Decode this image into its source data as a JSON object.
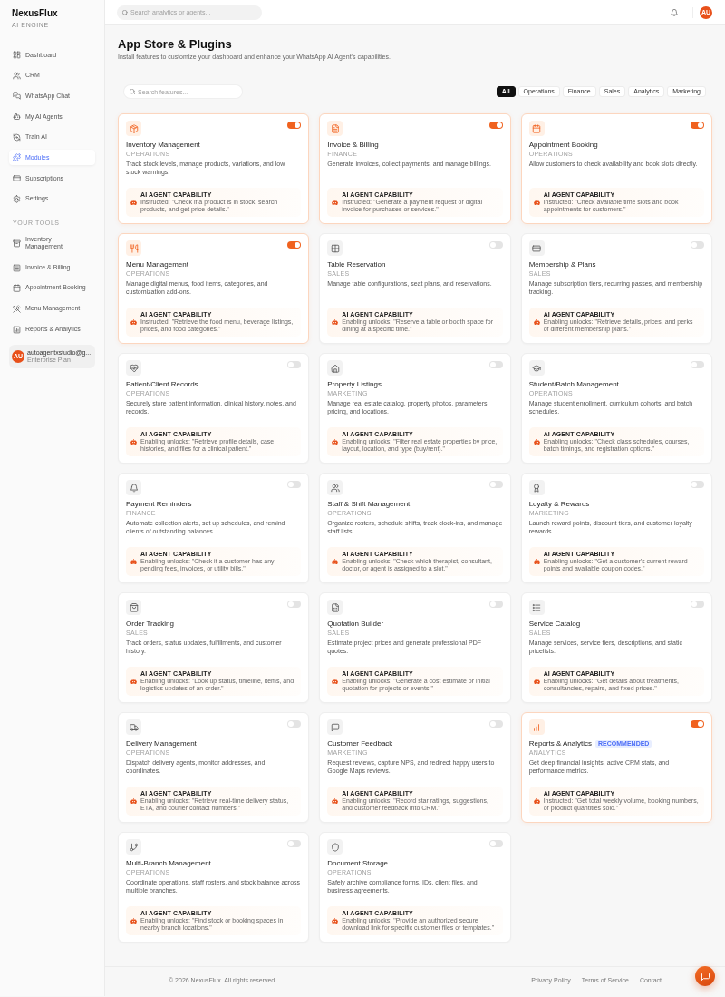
{
  "sidebar": {
    "brand": "NexusFlux",
    "tagline": "AI ENGINE",
    "nav": [
      {
        "label": "Dashboard",
        "selected": false
      },
      {
        "label": "CRM",
        "selected": false
      },
      {
        "label": "WhatsApp Chat",
        "selected": false
      },
      {
        "label": "My AI Agents",
        "selected": false
      },
      {
        "label": "Train AI",
        "selected": false
      },
      {
        "label": "Modules",
        "selected": true
      },
      {
        "label": "Subscriptions",
        "selected": false
      },
      {
        "label": "Settings",
        "selected": false
      }
    ],
    "section_title": "YOUR TOOLS",
    "tools": [
      "Inventory Management",
      "Invoice & Billing",
      "Appointment Booking",
      "Menu Management",
      "Reports & Analytics"
    ],
    "user": {
      "avatar": "AU",
      "email": "autoagentxstudio@g...",
      "plan": "Enterprise Plan"
    }
  },
  "header": {
    "search": {
      "placeholder": "Search analytics or agents..."
    },
    "avatar": "AU"
  },
  "page": {
    "title": "App Store & Plugins",
    "subtitle": "Install features to customize your dashboard and enhance your WhatsApp AI Agent's capabilities."
  },
  "search": {
    "placeholder": "Search features..."
  },
  "filters": [
    {
      "label": "All",
      "selected": true
    },
    {
      "label": "Operations",
      "selected": false
    },
    {
      "label": "Finance",
      "selected": false
    },
    {
      "label": "Sales",
      "selected": false
    },
    {
      "label": "Analytics",
      "selected": false
    },
    {
      "label": "Marketing",
      "selected": false
    }
  ],
  "modules": [
    {
      "title": "Inventory Management",
      "category": "OPERATIONS",
      "description": "Track stock levels, manage products, variations, and low stock warnings.",
      "enabled": true,
      "capability_label": "AI AGENT CAPABILITY",
      "capability": "Instructed: \"Check if a product is in stock, search products, and get price details.\""
    },
    {
      "title": "Invoice & Billing",
      "category": "FINANCE",
      "description": "Generate invoices, collect payments, and manage billings.",
      "enabled": true,
      "capability_label": "AI AGENT CAPABILITY",
      "capability": "Instructed: \"Generate a payment request or digital invoice for purchases or services.\""
    },
    {
      "title": "Appointment Booking",
      "category": "OPERATIONS",
      "description": "Allow customers to check availability and book slots directly.",
      "enabled": true,
      "capability_label": "AI AGENT CAPABILITY",
      "capability": "Instructed: \"Check available time slots and book appointments for customers.\""
    },
    {
      "title": "Menu Management",
      "category": "OPERATIONS",
      "description": "Manage digital menus, food items, categories, and customization add-ons.",
      "enabled": true,
      "capability_label": "AI AGENT CAPABILITY",
      "capability": "Instructed: \"Retrieve the food menu, beverage listings, prices, and food categories.\""
    },
    {
      "title": "Table Reservation",
      "category": "SALES",
      "description": "Manage table configurations, seat plans, and reservations.",
      "enabled": false,
      "capability_label": "AI AGENT CAPABILITY",
      "capability": "Enabling unlocks: \"Reserve a table or booth space for dining at a specific time.\""
    },
    {
      "title": "Membership & Plans",
      "category": "SALES",
      "description": "Manage subscription tiers, recurring passes, and membership tracking.",
      "enabled": false,
      "capability_label": "AI AGENT CAPABILITY",
      "capability": "Enabling unlocks: \"Retrieve details, prices, and perks of different membership plans.\""
    },
    {
      "title": "Patient/Client Records",
      "category": "OPERATIONS",
      "description": "Securely store patient information, clinical history, notes, and records.",
      "enabled": false,
      "capability_label": "AI AGENT CAPABILITY",
      "capability": "Enabling unlocks: \"Retrieve profile details, case histories, and files for a clinical patient.\""
    },
    {
      "title": "Property Listings",
      "category": "MARKETING",
      "description": "Manage real estate catalog, property photos, parameters, pricing, and locations.",
      "enabled": false,
      "capability_label": "AI AGENT CAPABILITY",
      "capability": "Enabling unlocks: \"Filter real estate properties by price, layout, location, and type (buy/rent).\""
    },
    {
      "title": "Student/Batch Management",
      "category": "OPERATIONS",
      "description": "Manage student enrollment, curriculum cohorts, and batch schedules.",
      "enabled": false,
      "capability_label": "AI AGENT CAPABILITY",
      "capability": "Enabling unlocks: \"Check class schedules, courses, batch timings, and registration options.\""
    },
    {
      "title": "Payment Reminders",
      "category": "FINANCE",
      "description": "Automate collection alerts, set up schedules, and remind clients of outstanding balances.",
      "enabled": false,
      "capability_label": "AI AGENT CAPABILITY",
      "capability": "Enabling unlocks: \"Check if a customer has any pending fees, invoices, or utility bills.\""
    },
    {
      "title": "Staff & Shift Management",
      "category": "OPERATIONS",
      "description": "Organize rosters, schedule shifts, track clock-ins, and manage staff lists.",
      "enabled": false,
      "capability_label": "AI AGENT CAPABILITY",
      "capability": "Enabling unlocks: \"Check which therapist, consultant, doctor, or agent is assigned to a slot.\""
    },
    {
      "title": "Loyalty & Rewards",
      "category": "MARKETING",
      "description": "Launch reward points, discount tiers, and customer loyalty rewards.",
      "enabled": false,
      "capability_label": "AI AGENT CAPABILITY",
      "capability": "Enabling unlocks: \"Get a customer's current reward points and available coupon codes.\""
    },
    {
      "title": "Order Tracking",
      "category": "SALES",
      "description": "Track orders, status updates, fulfillments, and customer history.",
      "enabled": false,
      "capability_label": "AI AGENT CAPABILITY",
      "capability": "Enabling unlocks: \"Look up status, timeline, items, and logistics updates of an order.\""
    },
    {
      "title": "Quotation Builder",
      "category": "SALES",
      "description": "Estimate project prices and generate professional PDF quotes.",
      "enabled": false,
      "capability_label": "AI AGENT CAPABILITY",
      "capability": "Enabling unlocks: \"Generate a cost estimate or initial quotation for projects or events.\""
    },
    {
      "title": "Service Catalog",
      "category": "SALES",
      "description": "Manage services, service tiers, descriptions, and static pricelists.",
      "enabled": false,
      "capability_label": "AI AGENT CAPABILITY",
      "capability": "Enabling unlocks: \"Get details about treatments, consultancies, repairs, and fixed prices.\""
    },
    {
      "title": "Delivery Management",
      "category": "OPERATIONS",
      "description": "Dispatch delivery agents, monitor addresses, and coordinates.",
      "enabled": false,
      "capability_label": "AI AGENT CAPABILITY",
      "capability": "Enabling unlocks: \"Retrieve real-time delivery status, ETA, and courier contact numbers.\""
    },
    {
      "title": "Customer Feedback",
      "category": "MARKETING",
      "description": "Request reviews, capture NPS, and redirect happy users to Google Maps reviews.",
      "enabled": false,
      "capability_label": "AI AGENT CAPABILITY",
      "capability": "Enabling unlocks: \"Record star ratings, suggestions, and customer feedback into CRM.\""
    },
    {
      "title": "Reports & Analytics",
      "badge": "RECOMMENDED",
      "category": "ANALYTICS",
      "description": "Get deep financial insights, active CRM stats, and performance metrics.",
      "enabled": true,
      "capability_label": "AI AGENT CAPABILITY",
      "capability": "Instructed: \"Get total weekly volume, booking numbers, or product quantities sold.\""
    },
    {
      "title": "Multi-Branch Management",
      "category": "OPERATIONS",
      "description": "Coordinate operations, staff rosters, and stock balance across multiple branches.",
      "enabled": false,
      "capability_label": "AI AGENT CAPABILITY",
      "capability": "Enabling unlocks: \"Find stock or booking spaces in nearby branch locations.\""
    },
    {
      "title": "Document Storage",
      "category": "OPERATIONS",
      "description": "Safely archive compliance forms, IDs, client files, and business agreements.",
      "enabled": false,
      "capability_label": "AI AGENT CAPABILITY",
      "capability": "Enabling unlocks: \"Provide an authorized secure download link for specific customer files or templates.\""
    }
  ],
  "footer": {
    "copyright": "© 2026 NexusFlux. All rights reserved.",
    "links": [
      "Privacy Policy",
      "Terms of Service",
      "Contact"
    ]
  }
}
